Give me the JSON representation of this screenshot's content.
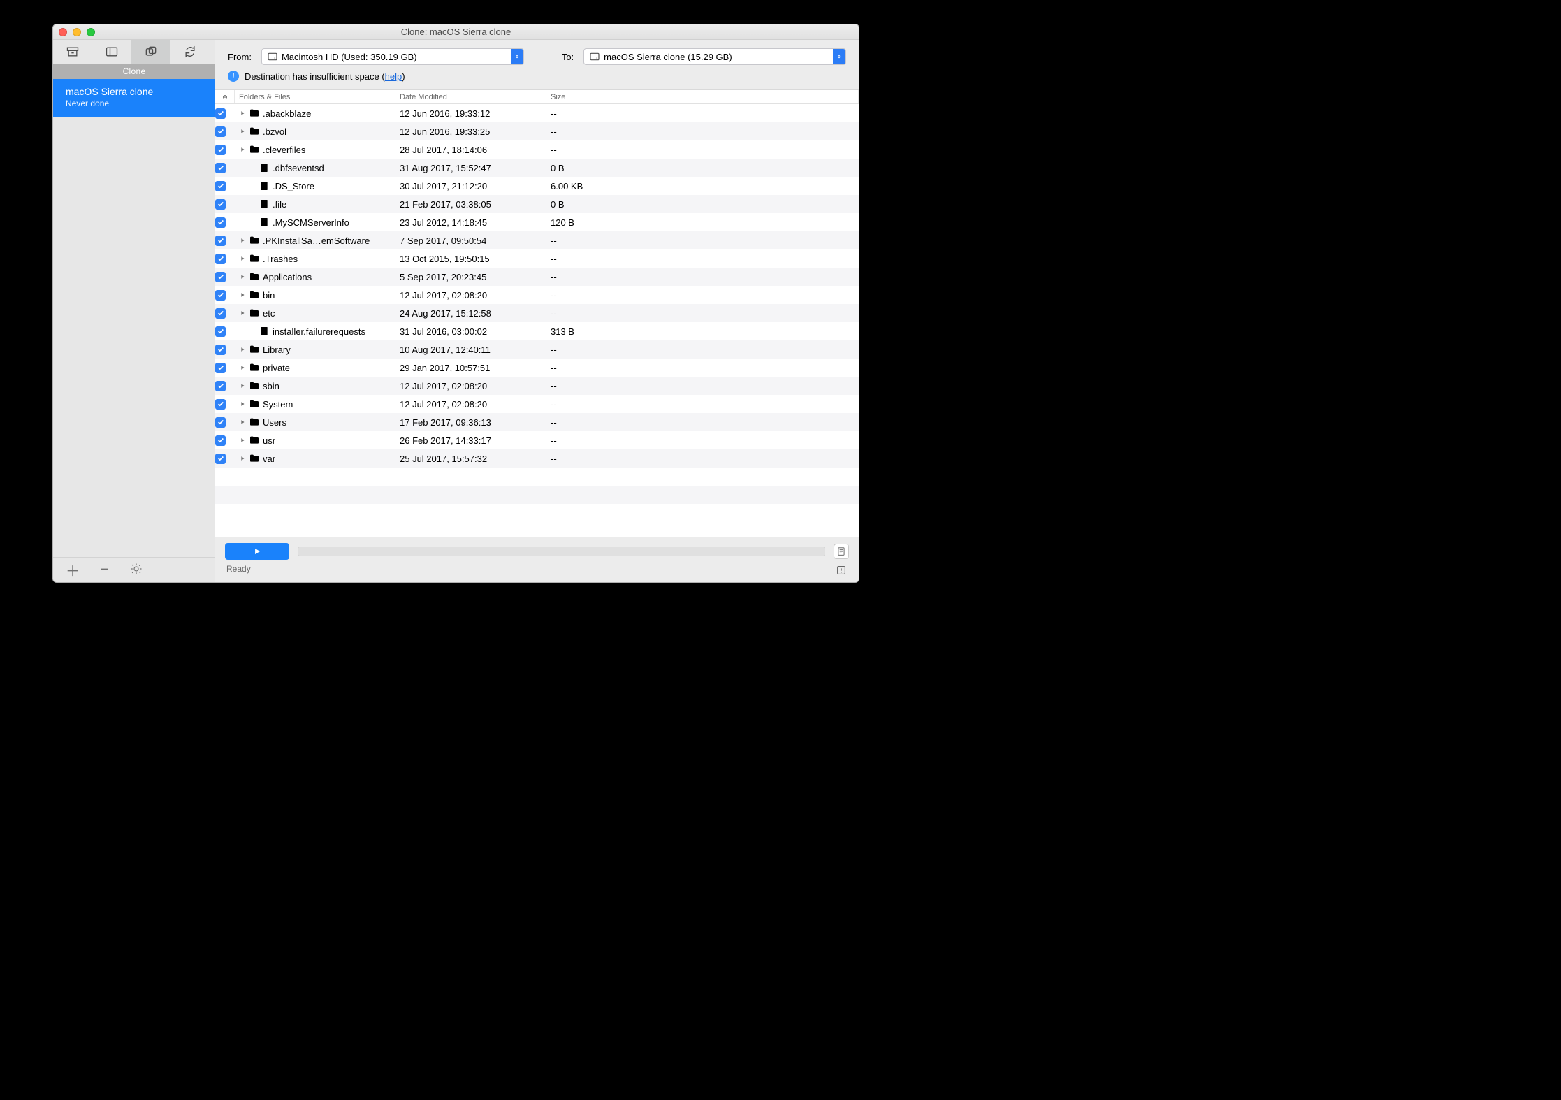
{
  "window": {
    "title": "Clone: macOS Sierra clone"
  },
  "sidebarTabLabel": "Clone",
  "task": {
    "name": "macOS Sierra clone",
    "subtitle": "Never done"
  },
  "source": {
    "label": "From:",
    "display": "Macintosh HD (Used: 350.19 GB)"
  },
  "destination": {
    "label": "To:",
    "display": "macOS Sierra clone (15.29 GB)"
  },
  "alert": {
    "text_before": "Destination has insufficient space (",
    "link": "help",
    "text_after": ")"
  },
  "columns": {
    "name": "Folders & Files",
    "date": "Date Modified",
    "size": "Size"
  },
  "rows": [
    {
      "type": "folder",
      "expandable": true,
      "name": ".abackblaze",
      "date": "12 Jun 2016, 19:33:12",
      "size": "--"
    },
    {
      "type": "folder",
      "expandable": true,
      "name": ".bzvol",
      "date": "12 Jun 2016, 19:33:25",
      "size": "--"
    },
    {
      "type": "folder",
      "expandable": true,
      "name": ".cleverfiles",
      "date": "28 Jul 2017, 18:14:06",
      "size": "--"
    },
    {
      "type": "exec",
      "expandable": false,
      "name": ".dbfseventsd",
      "date": "31 Aug 2017, 15:52:47",
      "size": "0 B"
    },
    {
      "type": "file",
      "expandable": false,
      "name": ".DS_Store",
      "date": "30 Jul 2017, 21:12:20",
      "size": "6.00 KB"
    },
    {
      "type": "file",
      "expandable": false,
      "name": ".file",
      "date": "21 Feb 2017, 03:38:05",
      "size": "0 B"
    },
    {
      "type": "exec",
      "expandable": false,
      "name": ".MySCMServerInfo",
      "date": "23 Jul 2012, 14:18:45",
      "size": "120 B"
    },
    {
      "type": "folder",
      "expandable": true,
      "name": ".PKInstallSa…emSoftware",
      "date": "7 Sep 2017, 09:50:54",
      "size": "--"
    },
    {
      "type": "folder",
      "expandable": true,
      "name": ".Trashes",
      "date": "13 Oct 2015, 19:50:15",
      "size": "--"
    },
    {
      "type": "sysfolder",
      "expandable": true,
      "name": "Applications",
      "date": "5 Sep 2017, 20:23:45",
      "size": "--"
    },
    {
      "type": "folder",
      "expandable": true,
      "name": "bin",
      "date": "12 Jul 2017, 02:08:20",
      "size": "--"
    },
    {
      "type": "folder",
      "expandable": true,
      "name": "etc",
      "date": "24 Aug 2017, 15:12:58",
      "size": "--"
    },
    {
      "type": "file",
      "expandable": false,
      "name": "installer.failurerequests",
      "date": "31 Jul 2016, 03:00:02",
      "size": "313 B"
    },
    {
      "type": "sysfolder",
      "expandable": true,
      "name": "Library",
      "date": "10 Aug 2017, 12:40:11",
      "size": "--"
    },
    {
      "type": "folder",
      "expandable": true,
      "name": "private",
      "date": "29 Jan 2017, 10:57:51",
      "size": "--"
    },
    {
      "type": "folder",
      "expandable": true,
      "name": "sbin",
      "date": "12 Jul 2017, 02:08:20",
      "size": "--"
    },
    {
      "type": "sysfolder",
      "expandable": true,
      "name": "System",
      "date": "12 Jul 2017, 02:08:20",
      "size": "--"
    },
    {
      "type": "sysfolder",
      "expandable": true,
      "name": "Users",
      "date": "17 Feb 2017, 09:36:13",
      "size": "--"
    },
    {
      "type": "folder",
      "expandable": true,
      "name": "usr",
      "date": "26 Feb 2017, 14:33:17",
      "size": "--"
    },
    {
      "type": "folder",
      "expandable": true,
      "name": "var",
      "date": "25 Jul 2017, 15:57:32",
      "size": "--"
    }
  ],
  "statusText": "Ready"
}
